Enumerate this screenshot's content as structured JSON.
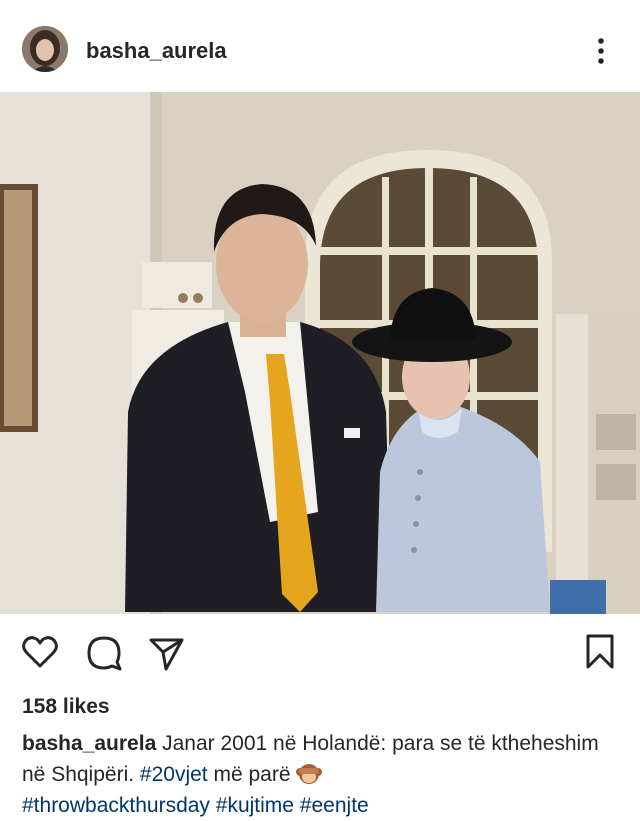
{
  "post": {
    "username": "basha_aurela",
    "likes": "158 likes",
    "caption": {
      "username": "basha_aurela",
      "text_1": "Janar 2001 në Holandë: para se të ktheheshim në Shqipëri.",
      "tag_1": "#20vjet",
      "text_2": "më parë",
      "emoji": "see-no-evil-monkey",
      "tag_2": "#throwbackthursday",
      "tag_3": "#kujtime",
      "tag_4": "#eenjte"
    }
  },
  "icons": {
    "avatar": "avatar",
    "more": "more-vertical-icon",
    "like": "heart-icon",
    "comment": "comment-icon",
    "share": "share-icon",
    "save": "bookmark-icon"
  },
  "colors": {
    "text": "#262626",
    "hashtag": "#00376b"
  }
}
